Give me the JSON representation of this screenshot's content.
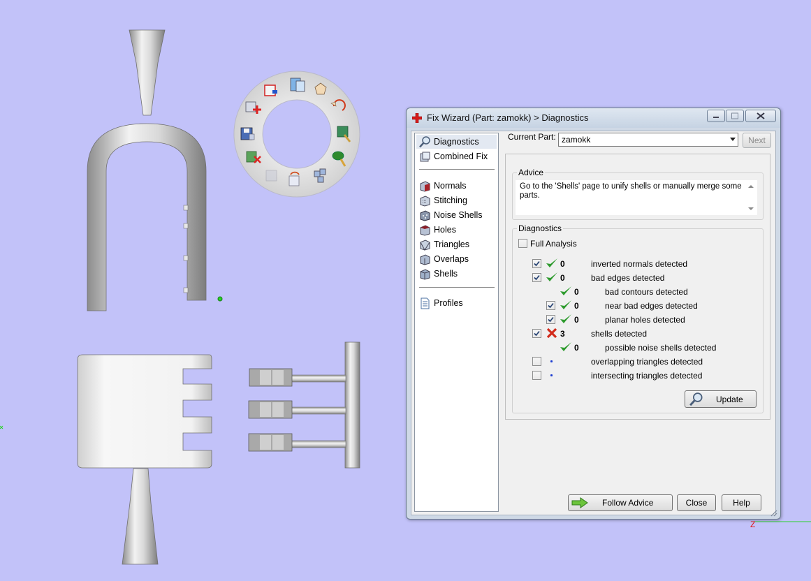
{
  "dialog": {
    "title": "Fix Wizard (Part: zamokk) > Diagnostics",
    "nav": {
      "top_items": [
        {
          "label": "Diagnostics",
          "icon": "magnifier-icon",
          "selected": true
        },
        {
          "label": "Combined Fix",
          "icon": "combined-fix-icon"
        }
      ],
      "middle_items": [
        {
          "label": "Normals",
          "icon": "normals-cube-icon"
        },
        {
          "label": "Stitching",
          "icon": "stitching-cube-icon"
        },
        {
          "label": "Noise Shells",
          "icon": "noise-shells-cube-icon"
        },
        {
          "label": "Holes",
          "icon": "holes-cube-icon"
        },
        {
          "label": "Triangles",
          "icon": "triangles-cube-icon"
        },
        {
          "label": "Overlaps",
          "icon": "overlaps-cube-icon"
        },
        {
          "label": "Shells",
          "icon": "shells-cube-icon"
        }
      ],
      "bottom_items": [
        {
          "label": "Profiles",
          "icon": "profiles-document-icon"
        }
      ]
    },
    "current_part": {
      "label": "Current Part:",
      "value": "zamokk",
      "next_label": "Next"
    },
    "advice": {
      "title": "Advice",
      "text": "Go to the 'Shells' page to unify shells or manually merge some parts."
    },
    "diagnostics": {
      "title": "Diagnostics",
      "full_analysis_label": "Full Analysis",
      "full_analysis_checked": false,
      "rows": [
        {
          "checked": true,
          "has_checkbox": true,
          "status": "ok",
          "count": "0",
          "label": "inverted normals detected",
          "indent": 0
        },
        {
          "checked": true,
          "has_checkbox": true,
          "status": "ok",
          "count": "0",
          "label": "bad edges detected",
          "indent": 0
        },
        {
          "checked": false,
          "has_checkbox": false,
          "status": "ok",
          "count": "0",
          "label": "bad contours detected",
          "indent": 1
        },
        {
          "checked": true,
          "has_checkbox": true,
          "status": "ok",
          "count": "0",
          "label": "near bad edges detected",
          "indent": 1
        },
        {
          "checked": true,
          "has_checkbox": true,
          "status": "ok",
          "count": "0",
          "label": "planar holes detected",
          "indent": 1
        },
        {
          "checked": true,
          "has_checkbox": true,
          "status": "error",
          "count": "3",
          "label": "shells detected",
          "indent": 0
        },
        {
          "checked": false,
          "has_checkbox": false,
          "status": "ok",
          "count": "0",
          "label": "possible noise shells detected",
          "indent": 1
        },
        {
          "checked": false,
          "has_checkbox": true,
          "status": "pending",
          "count": "",
          "label": "overlapping triangles detected",
          "indent": 0
        },
        {
          "checked": false,
          "has_checkbox": true,
          "status": "pending",
          "count": "",
          "label": "intersecting triangles detected",
          "indent": 0
        }
      ],
      "update_label": "Update"
    },
    "buttons": {
      "follow_advice": "Follow Advice",
      "close": "Close",
      "help": "Help"
    }
  },
  "viewport": {
    "background": "#c2c2f9",
    "axis_z_label": "Z",
    "radial_menu_icons": [
      "add-part-icon",
      "save-icon",
      "delete-part-icon",
      "bounding-box-icon",
      "views-icon",
      "pan-icon",
      "rotate-icon",
      "select-icon",
      "paint-icon",
      "refresh-icon",
      "cube-icon",
      "shells-icon"
    ]
  },
  "colors": {
    "ok": "#2e9b2e",
    "error": "#d22b1b",
    "pending": "#1c3dd1",
    "dialog_frame": "#cfd9e6"
  }
}
